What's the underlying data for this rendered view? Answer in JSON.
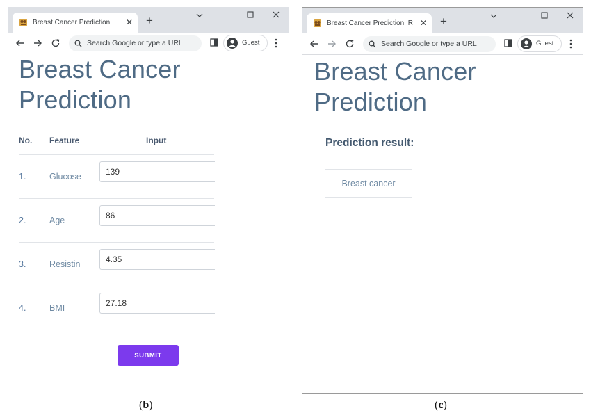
{
  "panel_b": {
    "caption_open": "(",
    "caption_letter": "b",
    "caption_close": ")",
    "tab_title": "Breast Cancer Prediction",
    "new_tab": "+",
    "omnibox_placeholder": "Search Google or type a URL",
    "guest_label": "Guest",
    "page_title_line1": "Breast Cancer",
    "page_title_line2": "Prediction",
    "table_headers": {
      "no": "No.",
      "feature": "Feature",
      "input": "Input"
    },
    "rows": [
      {
        "no": "1.",
        "feature": "Glucose",
        "value": "139"
      },
      {
        "no": "2.",
        "feature": "Age",
        "value": "86"
      },
      {
        "no": "3.",
        "feature": "Resistin",
        "value": "4.35"
      },
      {
        "no": "4.",
        "feature": "BMI",
        "value": "27.18"
      }
    ],
    "submit_label": "SUBMIT"
  },
  "panel_c": {
    "caption_open": "(",
    "caption_letter": "c",
    "caption_close": ")",
    "tab_title": "Breast Cancer Prediction: Res",
    "new_tab": "+",
    "omnibox_placeholder": "Search Google or type a URL",
    "guest_label": "Guest",
    "page_title_line1": "Breast Cancer",
    "page_title_line2": "Prediction",
    "result_label": "Prediction result:",
    "result_value": "Breast cancer"
  },
  "colors": {
    "title_text": "#4f6b85",
    "submit_button": "#7c3aed",
    "chrome_tabstrip": "#dee1e6"
  }
}
